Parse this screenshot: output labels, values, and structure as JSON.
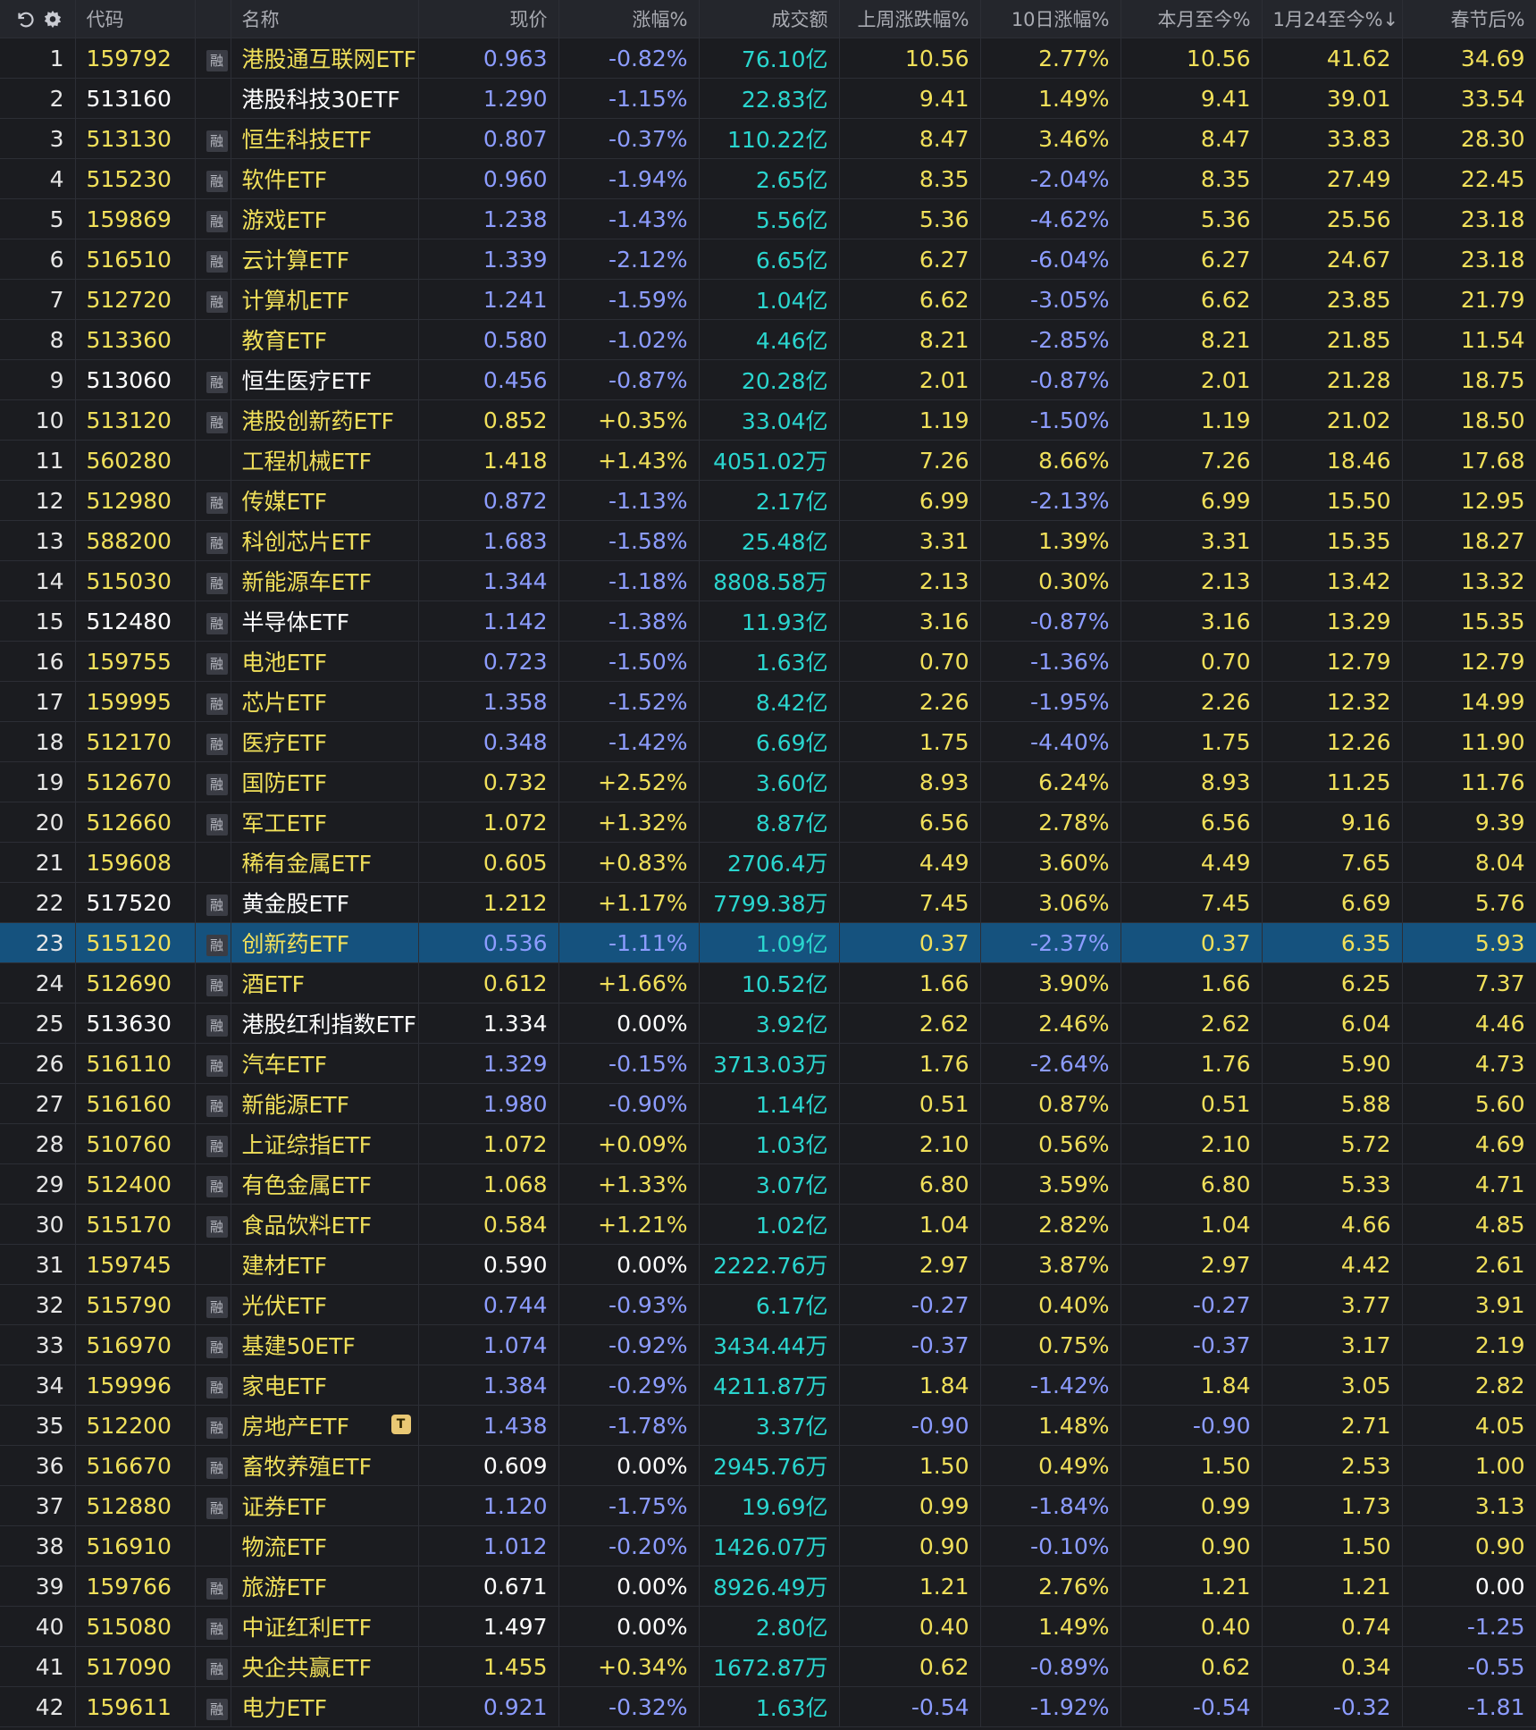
{
  "header": {
    "code": "代码",
    "name": "名称",
    "price": "现价",
    "change": "涨幅%",
    "turnover": "成交额",
    "last_week": "上周涨跌幅%",
    "ten_day": "10日涨幅%",
    "mtd": "本月至今%",
    "since_jan24": "1月24至今%↓",
    "after_festival": "春节后%"
  },
  "toolbar": {
    "refresh_icon": "refresh-icon",
    "settings_icon": "gear-icon"
  },
  "colors": {
    "up": "#f1e05a",
    "down": "#8c9cff",
    "flat": "#ffffff",
    "turnover": "#2ad6cf",
    "selected_row": "#15527e"
  },
  "margin_tag": "融",
  "t_badge": "T",
  "rows": [
    {
      "idx": "1",
      "code": "159792",
      "margin": true,
      "name": "港股通互联网ETF",
      "price": "0.963",
      "change": "-0.82%",
      "turnover": "76.10亿",
      "last_week": "10.56",
      "ten_day": "2.77%",
      "mtd": "10.56",
      "since_jan24": "41.62",
      "after_festival": "34.69",
      "dir": "down",
      "name_color": "up",
      "code_color": "up"
    },
    {
      "idx": "2",
      "code": "513160",
      "margin": false,
      "name": "港股科技30ETF",
      "price": "1.290",
      "change": "-1.15%",
      "turnover": "22.83亿",
      "last_week": "9.41",
      "ten_day": "1.49%",
      "mtd": "9.41",
      "since_jan24": "39.01",
      "after_festival": "33.54",
      "dir": "down",
      "name_color": "flat",
      "code_color": "flat"
    },
    {
      "idx": "3",
      "code": "513130",
      "margin": true,
      "name": "恒生科技ETF",
      "price": "0.807",
      "change": "-0.37%",
      "turnover": "110.22亿",
      "last_week": "8.47",
      "ten_day": "3.46%",
      "mtd": "8.47",
      "since_jan24": "33.83",
      "after_festival": "28.30",
      "dir": "down",
      "name_color": "up",
      "code_color": "up"
    },
    {
      "idx": "4",
      "code": "515230",
      "margin": true,
      "name": "软件ETF",
      "price": "0.960",
      "change": "-1.94%",
      "turnover": "2.65亿",
      "last_week": "8.35",
      "ten_day": "-2.04%",
      "mtd": "8.35",
      "since_jan24": "27.49",
      "after_festival": "22.45",
      "dir": "down",
      "name_color": "up",
      "code_color": "up"
    },
    {
      "idx": "5",
      "code": "159869",
      "margin": true,
      "name": "游戏ETF",
      "price": "1.238",
      "change": "-1.43%",
      "turnover": "5.56亿",
      "last_week": "5.36",
      "ten_day": "-4.62%",
      "mtd": "5.36",
      "since_jan24": "25.56",
      "after_festival": "23.18",
      "dir": "down",
      "name_color": "up",
      "code_color": "up"
    },
    {
      "idx": "6",
      "code": "516510",
      "margin": true,
      "name": "云计算ETF",
      "price": "1.339",
      "change": "-2.12%",
      "turnover": "6.65亿",
      "last_week": "6.27",
      "ten_day": "-6.04%",
      "mtd": "6.27",
      "since_jan24": "24.67",
      "after_festival": "23.18",
      "dir": "down",
      "name_color": "up",
      "code_color": "up"
    },
    {
      "idx": "7",
      "code": "512720",
      "margin": true,
      "name": "计算机ETF",
      "price": "1.241",
      "change": "-1.59%",
      "turnover": "1.04亿",
      "last_week": "6.62",
      "ten_day": "-3.05%",
      "mtd": "6.62",
      "since_jan24": "23.85",
      "after_festival": "21.79",
      "dir": "down",
      "name_color": "up",
      "code_color": "up"
    },
    {
      "idx": "8",
      "code": "513360",
      "margin": false,
      "name": "教育ETF",
      "price": "0.580",
      "change": "-1.02%",
      "turnover": "4.46亿",
      "last_week": "8.21",
      "ten_day": "-2.85%",
      "mtd": "8.21",
      "since_jan24": "21.85",
      "after_festival": "11.54",
      "dir": "down",
      "name_color": "up",
      "code_color": "up"
    },
    {
      "idx": "9",
      "code": "513060",
      "margin": true,
      "name": "恒生医疗ETF",
      "price": "0.456",
      "change": "-0.87%",
      "turnover": "20.28亿",
      "last_week": "2.01",
      "ten_day": "-0.87%",
      "mtd": "2.01",
      "since_jan24": "21.28",
      "after_festival": "18.75",
      "dir": "down",
      "name_color": "flat",
      "code_color": "flat"
    },
    {
      "idx": "10",
      "code": "513120",
      "margin": true,
      "name": "港股创新药ETF",
      "price": "0.852",
      "change": "+0.35%",
      "turnover": "33.04亿",
      "last_week": "1.19",
      "ten_day": "-1.50%",
      "mtd": "1.19",
      "since_jan24": "21.02",
      "after_festival": "18.50",
      "dir": "up",
      "name_color": "up",
      "code_color": "up"
    },
    {
      "idx": "11",
      "code": "560280",
      "margin": false,
      "name": "工程机械ETF",
      "price": "1.418",
      "change": "+1.43%",
      "turnover": "4051.02万",
      "last_week": "7.26",
      "ten_day": "8.66%",
      "mtd": "7.26",
      "since_jan24": "18.46",
      "after_festival": "17.68",
      "dir": "up",
      "name_color": "up",
      "code_color": "up"
    },
    {
      "idx": "12",
      "code": "512980",
      "margin": true,
      "name": "传媒ETF",
      "price": "0.872",
      "change": "-1.13%",
      "turnover": "2.17亿",
      "last_week": "6.99",
      "ten_day": "-2.13%",
      "mtd": "6.99",
      "since_jan24": "15.50",
      "after_festival": "12.95",
      "dir": "down",
      "name_color": "up",
      "code_color": "up"
    },
    {
      "idx": "13",
      "code": "588200",
      "margin": true,
      "name": "科创芯片ETF",
      "price": "1.683",
      "change": "-1.58%",
      "turnover": "25.48亿",
      "last_week": "3.31",
      "ten_day": "1.39%",
      "mtd": "3.31",
      "since_jan24": "15.35",
      "after_festival": "18.27",
      "dir": "down",
      "name_color": "up",
      "code_color": "up"
    },
    {
      "idx": "14",
      "code": "515030",
      "margin": true,
      "name": "新能源车ETF",
      "price": "1.344",
      "change": "-1.18%",
      "turnover": "8808.58万",
      "last_week": "2.13",
      "ten_day": "0.30%",
      "mtd": "2.13",
      "since_jan24": "13.42",
      "after_festival": "13.32",
      "dir": "down",
      "name_color": "up",
      "code_color": "up"
    },
    {
      "idx": "15",
      "code": "512480",
      "margin": true,
      "name": "半导体ETF",
      "price": "1.142",
      "change": "-1.38%",
      "turnover": "11.93亿",
      "last_week": "3.16",
      "ten_day": "-0.87%",
      "mtd": "3.16",
      "since_jan24": "13.29",
      "after_festival": "15.35",
      "dir": "down",
      "name_color": "flat",
      "code_color": "flat"
    },
    {
      "idx": "16",
      "code": "159755",
      "margin": true,
      "name": "电池ETF",
      "price": "0.723",
      "change": "-1.50%",
      "turnover": "1.63亿",
      "last_week": "0.70",
      "ten_day": "-1.36%",
      "mtd": "0.70",
      "since_jan24": "12.79",
      "after_festival": "12.79",
      "dir": "down",
      "name_color": "up",
      "code_color": "up"
    },
    {
      "idx": "17",
      "code": "159995",
      "margin": true,
      "name": "芯片ETF",
      "price": "1.358",
      "change": "-1.52%",
      "turnover": "8.42亿",
      "last_week": "2.26",
      "ten_day": "-1.95%",
      "mtd": "2.26",
      "since_jan24": "12.32",
      "after_festival": "14.99",
      "dir": "down",
      "name_color": "up",
      "code_color": "up"
    },
    {
      "idx": "18",
      "code": "512170",
      "margin": true,
      "name": "医疗ETF",
      "price": "0.348",
      "change": "-1.42%",
      "turnover": "6.69亿",
      "last_week": "1.75",
      "ten_day": "-4.40%",
      "mtd": "1.75",
      "since_jan24": "12.26",
      "after_festival": "11.90",
      "dir": "down",
      "name_color": "up",
      "code_color": "up"
    },
    {
      "idx": "19",
      "code": "512670",
      "margin": true,
      "name": "国防ETF",
      "price": "0.732",
      "change": "+2.52%",
      "turnover": "3.60亿",
      "last_week": "8.93",
      "ten_day": "6.24%",
      "mtd": "8.93",
      "since_jan24": "11.25",
      "after_festival": "11.76",
      "dir": "up",
      "name_color": "up",
      "code_color": "up"
    },
    {
      "idx": "20",
      "code": "512660",
      "margin": true,
      "name": "军工ETF",
      "price": "1.072",
      "change": "+1.32%",
      "turnover": "8.87亿",
      "last_week": "6.56",
      "ten_day": "2.78%",
      "mtd": "6.56",
      "since_jan24": "9.16",
      "after_festival": "9.39",
      "dir": "up",
      "name_color": "up",
      "code_color": "up"
    },
    {
      "idx": "21",
      "code": "159608",
      "margin": false,
      "name": "稀有金属ETF",
      "price": "0.605",
      "change": "+0.83%",
      "turnover": "2706.4万",
      "last_week": "4.49",
      "ten_day": "3.60%",
      "mtd": "4.49",
      "since_jan24": "7.65",
      "after_festival": "8.04",
      "dir": "up",
      "name_color": "up",
      "code_color": "up"
    },
    {
      "idx": "22",
      "code": "517520",
      "margin": true,
      "name": "黄金股ETF",
      "price": "1.212",
      "change": "+1.17%",
      "turnover": "7799.38万",
      "last_week": "7.45",
      "ten_day": "3.06%",
      "mtd": "7.45",
      "since_jan24": "6.69",
      "after_festival": "5.76",
      "dir": "up",
      "name_color": "flat",
      "code_color": "flat"
    },
    {
      "idx": "23",
      "code": "515120",
      "margin": true,
      "name": "创新药ETF",
      "price": "0.536",
      "change": "-1.11%",
      "turnover": "1.09亿",
      "last_week": "0.37",
      "ten_day": "-2.37%",
      "mtd": "0.37",
      "since_jan24": "6.35",
      "after_festival": "5.93",
      "dir": "down",
      "name_color": "up",
      "code_color": "up",
      "selected": true
    },
    {
      "idx": "24",
      "code": "512690",
      "margin": true,
      "name": "酒ETF",
      "price": "0.612",
      "change": "+1.66%",
      "turnover": "10.52亿",
      "last_week": "1.66",
      "ten_day": "3.90%",
      "mtd": "1.66",
      "since_jan24": "6.25",
      "after_festival": "7.37",
      "dir": "up",
      "name_color": "up",
      "code_color": "up"
    },
    {
      "idx": "25",
      "code": "513630",
      "margin": true,
      "name": "港股红利指数ETF",
      "price": "1.334",
      "change": "0.00%",
      "turnover": "3.92亿",
      "last_week": "2.62",
      "ten_day": "2.46%",
      "mtd": "2.62",
      "since_jan24": "6.04",
      "after_festival": "4.46",
      "dir": "flat",
      "name_color": "flat",
      "code_color": "flat"
    },
    {
      "idx": "26",
      "code": "516110",
      "margin": true,
      "name": "汽车ETF",
      "price": "1.329",
      "change": "-0.15%",
      "turnover": "3713.03万",
      "last_week": "1.76",
      "ten_day": "-2.64%",
      "mtd": "1.76",
      "since_jan24": "5.90",
      "after_festival": "4.73",
      "dir": "down",
      "name_color": "up",
      "code_color": "up"
    },
    {
      "idx": "27",
      "code": "516160",
      "margin": true,
      "name": "新能源ETF",
      "price": "1.980",
      "change": "-0.90%",
      "turnover": "1.14亿",
      "last_week": "0.51",
      "ten_day": "0.87%",
      "mtd": "0.51",
      "since_jan24": "5.88",
      "after_festival": "5.60",
      "dir": "down",
      "name_color": "up",
      "code_color": "up"
    },
    {
      "idx": "28",
      "code": "510760",
      "margin": true,
      "name": "上证综指ETF",
      "price": "1.072",
      "change": "+0.09%",
      "turnover": "1.03亿",
      "last_week": "2.10",
      "ten_day": "0.56%",
      "mtd": "2.10",
      "since_jan24": "5.72",
      "after_festival": "4.69",
      "dir": "up",
      "name_color": "up",
      "code_color": "up"
    },
    {
      "idx": "29",
      "code": "512400",
      "margin": true,
      "name": "有色金属ETF",
      "price": "1.068",
      "change": "+1.33%",
      "turnover": "3.07亿",
      "last_week": "6.80",
      "ten_day": "3.59%",
      "mtd": "6.80",
      "since_jan24": "5.33",
      "after_festival": "4.71",
      "dir": "up",
      "name_color": "up",
      "code_color": "up"
    },
    {
      "idx": "30",
      "code": "515170",
      "margin": true,
      "name": "食品饮料ETF",
      "price": "0.584",
      "change": "+1.21%",
      "turnover": "1.02亿",
      "last_week": "1.04",
      "ten_day": "2.82%",
      "mtd": "1.04",
      "since_jan24": "4.66",
      "after_festival": "4.85",
      "dir": "up",
      "name_color": "up",
      "code_color": "up"
    },
    {
      "idx": "31",
      "code": "159745",
      "margin": false,
      "name": "建材ETF",
      "price": "0.590",
      "change": "0.00%",
      "turnover": "2222.76万",
      "last_week": "2.97",
      "ten_day": "3.87%",
      "mtd": "2.97",
      "since_jan24": "4.42",
      "after_festival": "2.61",
      "dir": "flat",
      "name_color": "up",
      "code_color": "up"
    },
    {
      "idx": "32",
      "code": "515790",
      "margin": true,
      "name": "光伏ETF",
      "price": "0.744",
      "change": "-0.93%",
      "turnover": "6.17亿",
      "last_week": "-0.27",
      "ten_day": "0.40%",
      "mtd": "-0.27",
      "since_jan24": "3.77",
      "after_festival": "3.91",
      "dir": "down",
      "name_color": "up",
      "code_color": "up"
    },
    {
      "idx": "33",
      "code": "516970",
      "margin": true,
      "name": "基建50ETF",
      "price": "1.074",
      "change": "-0.92%",
      "turnover": "3434.44万",
      "last_week": "-0.37",
      "ten_day": "0.75%",
      "mtd": "-0.37",
      "since_jan24": "3.17",
      "after_festival": "2.19",
      "dir": "down",
      "name_color": "up",
      "code_color": "up"
    },
    {
      "idx": "34",
      "code": "159996",
      "margin": true,
      "name": "家电ETF",
      "price": "1.384",
      "change": "-0.29%",
      "turnover": "4211.87万",
      "last_week": "1.84",
      "ten_day": "-1.42%",
      "mtd": "1.84",
      "since_jan24": "3.05",
      "after_festival": "2.82",
      "dir": "down",
      "name_color": "up",
      "code_color": "up"
    },
    {
      "idx": "35",
      "code": "512200",
      "margin": true,
      "name": "房地产ETF",
      "price": "1.438",
      "change": "-1.78%",
      "turnover": "3.37亿",
      "last_week": "-0.90",
      "ten_day": "1.48%",
      "mtd": "-0.90",
      "since_jan24": "2.71",
      "after_festival": "4.05",
      "dir": "down",
      "name_color": "up",
      "code_color": "up",
      "t_badge": true
    },
    {
      "idx": "36",
      "code": "516670",
      "margin": true,
      "name": "畜牧养殖ETF",
      "price": "0.609",
      "change": "0.00%",
      "turnover": "2945.76万",
      "last_week": "1.50",
      "ten_day": "0.49%",
      "mtd": "1.50",
      "since_jan24": "2.53",
      "after_festival": "1.00",
      "dir": "flat",
      "name_color": "up",
      "code_color": "up"
    },
    {
      "idx": "37",
      "code": "512880",
      "margin": true,
      "name": "证券ETF",
      "price": "1.120",
      "change": "-1.75%",
      "turnover": "19.69亿",
      "last_week": "0.99",
      "ten_day": "-1.84%",
      "mtd": "0.99",
      "since_jan24": "1.73",
      "after_festival": "3.13",
      "dir": "down",
      "name_color": "up",
      "code_color": "up"
    },
    {
      "idx": "38",
      "code": "516910",
      "margin": false,
      "name": "物流ETF",
      "price": "1.012",
      "change": "-0.20%",
      "turnover": "1426.07万",
      "last_week": "0.90",
      "ten_day": "-0.10%",
      "mtd": "0.90",
      "since_jan24": "1.50",
      "after_festival": "0.90",
      "dir": "down",
      "name_color": "up",
      "code_color": "up"
    },
    {
      "idx": "39",
      "code": "159766",
      "margin": true,
      "name": "旅游ETF",
      "price": "0.671",
      "change": "0.00%",
      "turnover": "8926.49万",
      "last_week": "1.21",
      "ten_day": "2.76%",
      "mtd": "1.21",
      "since_jan24": "1.21",
      "after_festival": "0.00",
      "dir": "flat",
      "name_color": "up",
      "code_color": "up"
    },
    {
      "idx": "40",
      "code": "515080",
      "margin": true,
      "name": "中证红利ETF",
      "price": "1.497",
      "change": "0.00%",
      "turnover": "2.80亿",
      "last_week": "0.40",
      "ten_day": "1.49%",
      "mtd": "0.40",
      "since_jan24": "0.74",
      "after_festival": "-1.25",
      "dir": "flat",
      "name_color": "up",
      "code_color": "up"
    },
    {
      "idx": "41",
      "code": "517090",
      "margin": true,
      "name": "央企共赢ETF",
      "price": "1.455",
      "change": "+0.34%",
      "turnover": "1672.87万",
      "last_week": "0.62",
      "ten_day": "-0.89%",
      "mtd": "0.62",
      "since_jan24": "0.34",
      "after_festival": "-0.55",
      "dir": "up",
      "name_color": "up",
      "code_color": "up"
    },
    {
      "idx": "42",
      "code": "159611",
      "margin": true,
      "name": "电力ETF",
      "price": "0.921",
      "change": "-0.32%",
      "turnover": "1.63亿",
      "last_week": "-0.54",
      "ten_day": "-1.92%",
      "mtd": "-0.54",
      "since_jan24": "-0.32",
      "after_festival": "-1.81",
      "dir": "down",
      "name_color": "up",
      "code_color": "up"
    }
  ]
}
